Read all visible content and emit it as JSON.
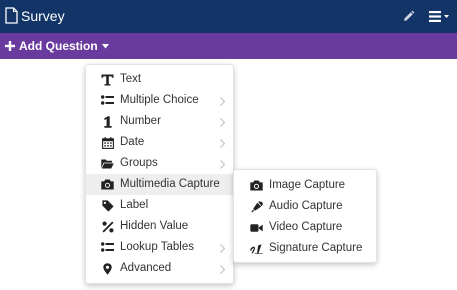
{
  "header": {
    "title": "Survey",
    "background": "#123466",
    "icons": [
      "document-icon",
      "pencil-icon",
      "hamburger-menu-icon",
      "caret-down-icon"
    ]
  },
  "actionbar": {
    "add_question_label": "Add Question",
    "background": "#6a3b9e"
  },
  "question_menu": {
    "items": [
      {
        "label": "Text",
        "icon": "text-t-icon",
        "has_submenu": false
      },
      {
        "label": "Multiple Choice",
        "icon": "list-icon",
        "has_submenu": true
      },
      {
        "label": "Number",
        "icon": "number-one-icon",
        "has_submenu": true
      },
      {
        "label": "Date",
        "icon": "calendar-icon",
        "has_submenu": true
      },
      {
        "label": "Groups",
        "icon": "folder-icon",
        "has_submenu": true
      },
      {
        "label": "Multimedia Capture",
        "icon": "camera-icon",
        "has_submenu": false,
        "active": true
      },
      {
        "label": "Label",
        "icon": "tag-icon",
        "has_submenu": false
      },
      {
        "label": "Hidden Value",
        "icon": "percent-icon",
        "has_submenu": false
      },
      {
        "label": "Lookup Tables",
        "icon": "list-icon",
        "has_submenu": true
      },
      {
        "label": "Advanced",
        "icon": "map-marker-icon",
        "has_submenu": true
      }
    ]
  },
  "multimedia_submenu": {
    "items": [
      {
        "label": "Image Capture",
        "icon": "camera-icon"
      },
      {
        "label": "Audio Capture",
        "icon": "microphone-icon"
      },
      {
        "label": "Video Capture",
        "icon": "video-camera-icon"
      },
      {
        "label": "Signature Capture",
        "icon": "signature-icon"
      }
    ]
  }
}
